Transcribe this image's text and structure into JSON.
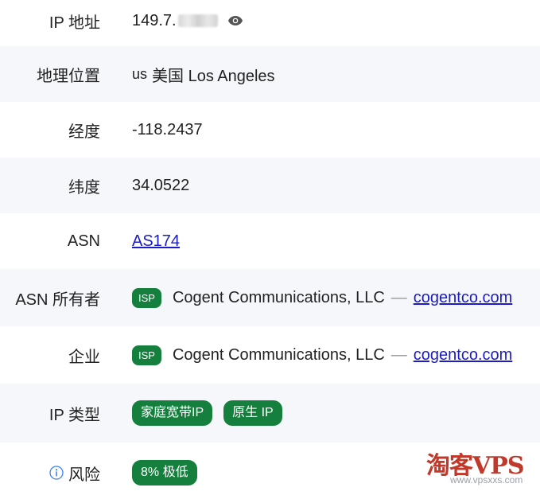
{
  "rows": {
    "ip": {
      "label": "IP 地址",
      "value": "149.7."
    },
    "location": {
      "label": "地理位置",
      "country_code": "us",
      "value": "美国 Los Angeles"
    },
    "longitude": {
      "label": "经度",
      "value": "-118.2437"
    },
    "latitude": {
      "label": "纬度",
      "value": "34.0522"
    },
    "asn": {
      "label": "ASN",
      "value": "AS174"
    },
    "asn_owner": {
      "label": "ASN 所有者",
      "badge": "ISP",
      "name": "Cogent Communications, LLC",
      "dash": "—",
      "domain": "cogentco.com"
    },
    "company": {
      "label": "企业",
      "badge": "ISP",
      "name": "Cogent Communications, LLC",
      "dash": "—",
      "domain": "cogentco.com"
    },
    "ip_type": {
      "label": "IP 类型",
      "tags": [
        "家庭宽带IP",
        "原生 IP"
      ]
    },
    "risk": {
      "label": "风险",
      "value": "8% 极低"
    }
  },
  "watermark": {
    "main": "淘客VPS",
    "sub": "www.vpsxxs.com"
  },
  "colors": {
    "accent_green": "#15803d",
    "link": "#1b1bc7",
    "row_alt_bg": "#f5f7fa",
    "watermark_red": "#c0392b"
  },
  "icons": {
    "ip_toggle": "eye-icon",
    "risk_info": "info-icon"
  }
}
